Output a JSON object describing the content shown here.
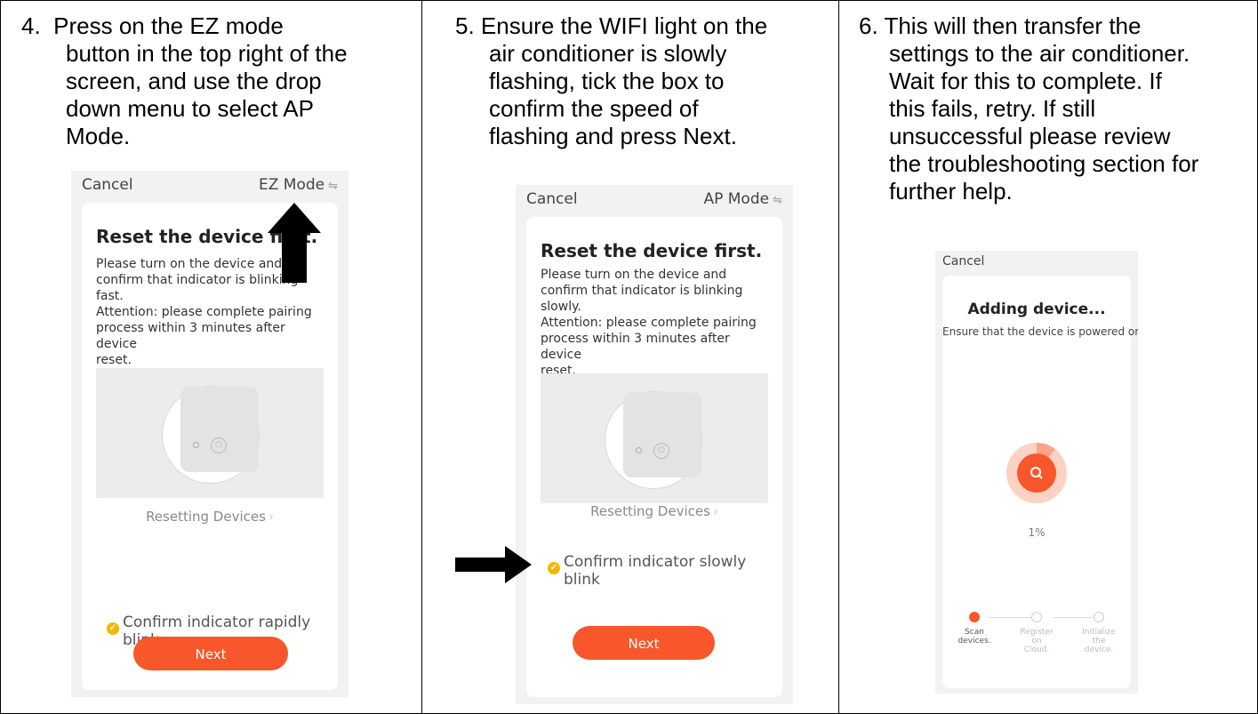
{
  "steps": [
    {
      "number": "4.",
      "text_first": "Press on the EZ mode",
      "text_rest": [
        "button in the top right of the",
        "screen, and use the drop",
        "down menu to select AP",
        "Mode."
      ],
      "screen": {
        "cancel": "Cancel",
        "mode": "EZ Mode",
        "title": "Reset the device first.",
        "body": [
          "Please turn on the device and",
          "confirm that indicator is blinking",
          "fast.",
          "Attention: please complete pairing",
          "process within 3 minutes after device",
          "reset."
        ],
        "reset_link": "Resetting Devices",
        "confirm": [
          "Confirm indicator rapidly",
          "blink"
        ],
        "next": "Next"
      }
    },
    {
      "number": "5.",
      "text_first": "Ensure the WIFI light on the",
      "text_rest": [
        "air conditioner is slowly",
        "flashing, tick the box to",
        "confirm the speed of",
        "flashing and press Next."
      ],
      "screen": {
        "cancel": "Cancel",
        "mode": "AP Mode",
        "title": "Reset the device first.",
        "body": [
          "Please turn on the device and",
          "confirm that indicator is blinking",
          "slowly.",
          "Attention: please complete pairing",
          "process within 3 minutes after device",
          "reset."
        ],
        "reset_link": "Resetting Devices",
        "confirm": [
          "Confirm indicator slowly",
          "blink"
        ],
        "next": "Next"
      }
    },
    {
      "number": "6.",
      "text_first": "This will then transfer the",
      "text_rest": [
        "settings to the air conditioner.",
        "Wait for this to complete. If",
        "this fails, retry. If still",
        "unsuccessful please review",
        "the troubleshooting section for",
        "further help."
      ],
      "screen": {
        "cancel": "Cancel",
        "title": "Adding device...",
        "subtitle": "Ensure that the device is powered on.",
        "progress_text": "1%",
        "progress": 0.01,
        "stages": [
          {
            "label": [
              "Scan",
              "devices."
            ],
            "state": "active"
          },
          {
            "label": [
              "Register",
              "on",
              "Cloud."
            ],
            "state": "inactive"
          },
          {
            "label": [
              "Initialize",
              "the",
              "device."
            ],
            "state": "inactive"
          }
        ]
      }
    }
  ],
  "colors": {
    "accent": "#f7572b",
    "check": "#f2b705",
    "border": "#000000"
  },
  "icons": [
    "arrow-up-icon",
    "arrow-right-icon",
    "wifi-switch-icon",
    "power-icon",
    "search-icon",
    "check-icon"
  ]
}
